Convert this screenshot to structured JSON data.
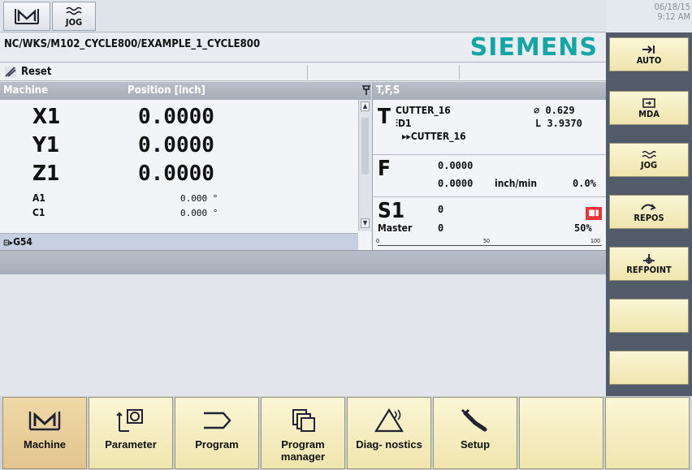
{
  "topbar": {
    "mode_machine_label": "M",
    "mode_jog_label": "JOG",
    "date": "06/18/15",
    "time": "9:12 AM"
  },
  "path": {
    "text": "NC/WKS/M102_CYCLE800/EXAMPLE_1_CYCLE800",
    "brand": "SIEMENS"
  },
  "status": {
    "reset_label": "Reset"
  },
  "machine": {
    "header_machine": "Machine",
    "header_position": "Position [inch]",
    "axes": [
      {
        "name": "X1",
        "value": "0.0000"
      },
      {
        "name": "Y1",
        "value": "0.0000"
      },
      {
        "name": "Z1",
        "value": "0.0000"
      }
    ],
    "rot_axes": [
      {
        "name": "A1",
        "value": "0.000 °"
      },
      {
        "name": "C1",
        "value": "0.000 °"
      }
    ],
    "zero_offset": "G54"
  },
  "tfs": {
    "header": "T,F,S",
    "t_letter": "T",
    "tool_name": "CUTTER_16",
    "diameter": "∅ 0.629",
    "d_number": "D1",
    "length": "L 3.9370",
    "next_tool": "▸▸CUTTER_16",
    "f_letter": "F",
    "feed_actual": "0.0000",
    "feed_set": "0.0000",
    "feed_unit": "inch/min",
    "feed_override": "0.0%",
    "s_letter": "S1",
    "spindle_value": "0",
    "master_label": "Master",
    "master_value": "0",
    "spindle_override": "50%",
    "scale_0": "0",
    "scale_50": "50",
    "scale_100": "100"
  },
  "vkeys": [
    "AUTO",
    "MDA",
    "JOG",
    "REPOS",
    "REFPOINT"
  ],
  "hkeys": [
    "Machine",
    "Parameter",
    "Program",
    "Program manager",
    "Diag- nostics",
    "Setup"
  ]
}
